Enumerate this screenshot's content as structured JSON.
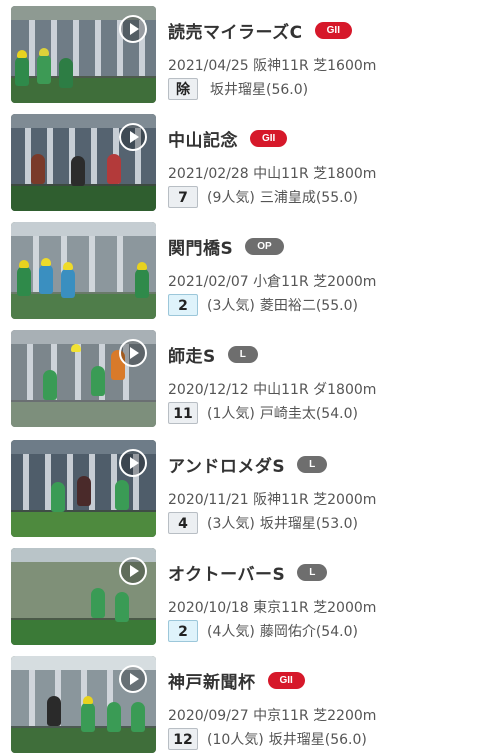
{
  "races": [
    {
      "name": "読売マイラーズC",
      "grade": "GII",
      "meta": "2021/04/25 阪神11R 芝1600m",
      "finish": "除",
      "popularity": "",
      "jockey": "坂井瑠星(56.0)"
    },
    {
      "name": "中山記念",
      "grade": "GII",
      "meta": "2021/02/28 中山11R 芝1800m",
      "finish": "7",
      "popularity": "(9人気)",
      "jockey": "三浦皇成(55.0)"
    },
    {
      "name": "関門橋S",
      "grade": "OP",
      "meta": "2021/02/07 小倉11R 芝2000m",
      "finish": "2",
      "popularity": "(3人気)",
      "jockey": "菱田裕二(55.0)"
    },
    {
      "name": "師走S",
      "grade": "L",
      "meta": "2020/12/12 中山11R ダ1800m",
      "finish": "11",
      "popularity": "(1人気)",
      "jockey": "戸崎圭太(54.0)"
    },
    {
      "name": "アンドロメダS",
      "grade": "L",
      "meta": "2020/11/21 阪神11R 芝2000m",
      "finish": "4",
      "popularity": "(3人気)",
      "jockey": "坂井瑠星(53.0)"
    },
    {
      "name": "オクトーバーS",
      "grade": "L",
      "meta": "2020/10/18 東京11R 芝2000m",
      "finish": "2",
      "popularity": "(4人気)",
      "jockey": "藤岡佑介(54.0)"
    },
    {
      "name": "神戸新聞杯",
      "grade": "GII",
      "meta": "2020/09/27 中京11R 芝2200m",
      "finish": "12",
      "popularity": "(10人気)",
      "jockey": "坂井瑠星(56.0)"
    }
  ],
  "colors": {
    "grade_g2": "#d6182a",
    "grade_open": "#6e6e6e",
    "badge_top3": "#dff3fb",
    "badge_default": "#eceff2"
  },
  "icons": {
    "play": "play-circle-icon"
  }
}
